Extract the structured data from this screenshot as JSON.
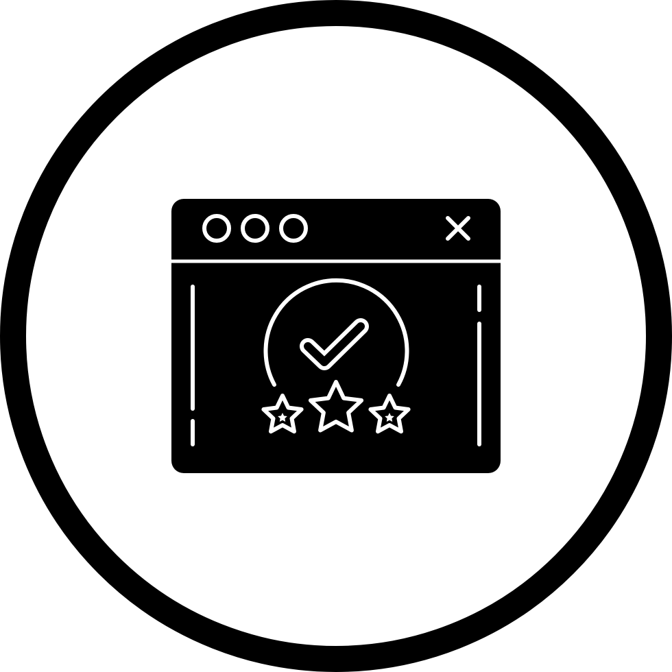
{
  "icon": {
    "name": "website-rating-icon",
    "colors": {
      "background": "#ffffff",
      "foreground": "#000000",
      "knockout": "#ffffff"
    },
    "window": {
      "controls": [
        "circle-dot-icon",
        "circle-dot-icon",
        "circle-dot-icon"
      ],
      "close": "close-icon"
    },
    "badge": {
      "check": "checkmark-icon",
      "stars": [
        "star-icon",
        "star-icon",
        "star-icon"
      ]
    }
  }
}
